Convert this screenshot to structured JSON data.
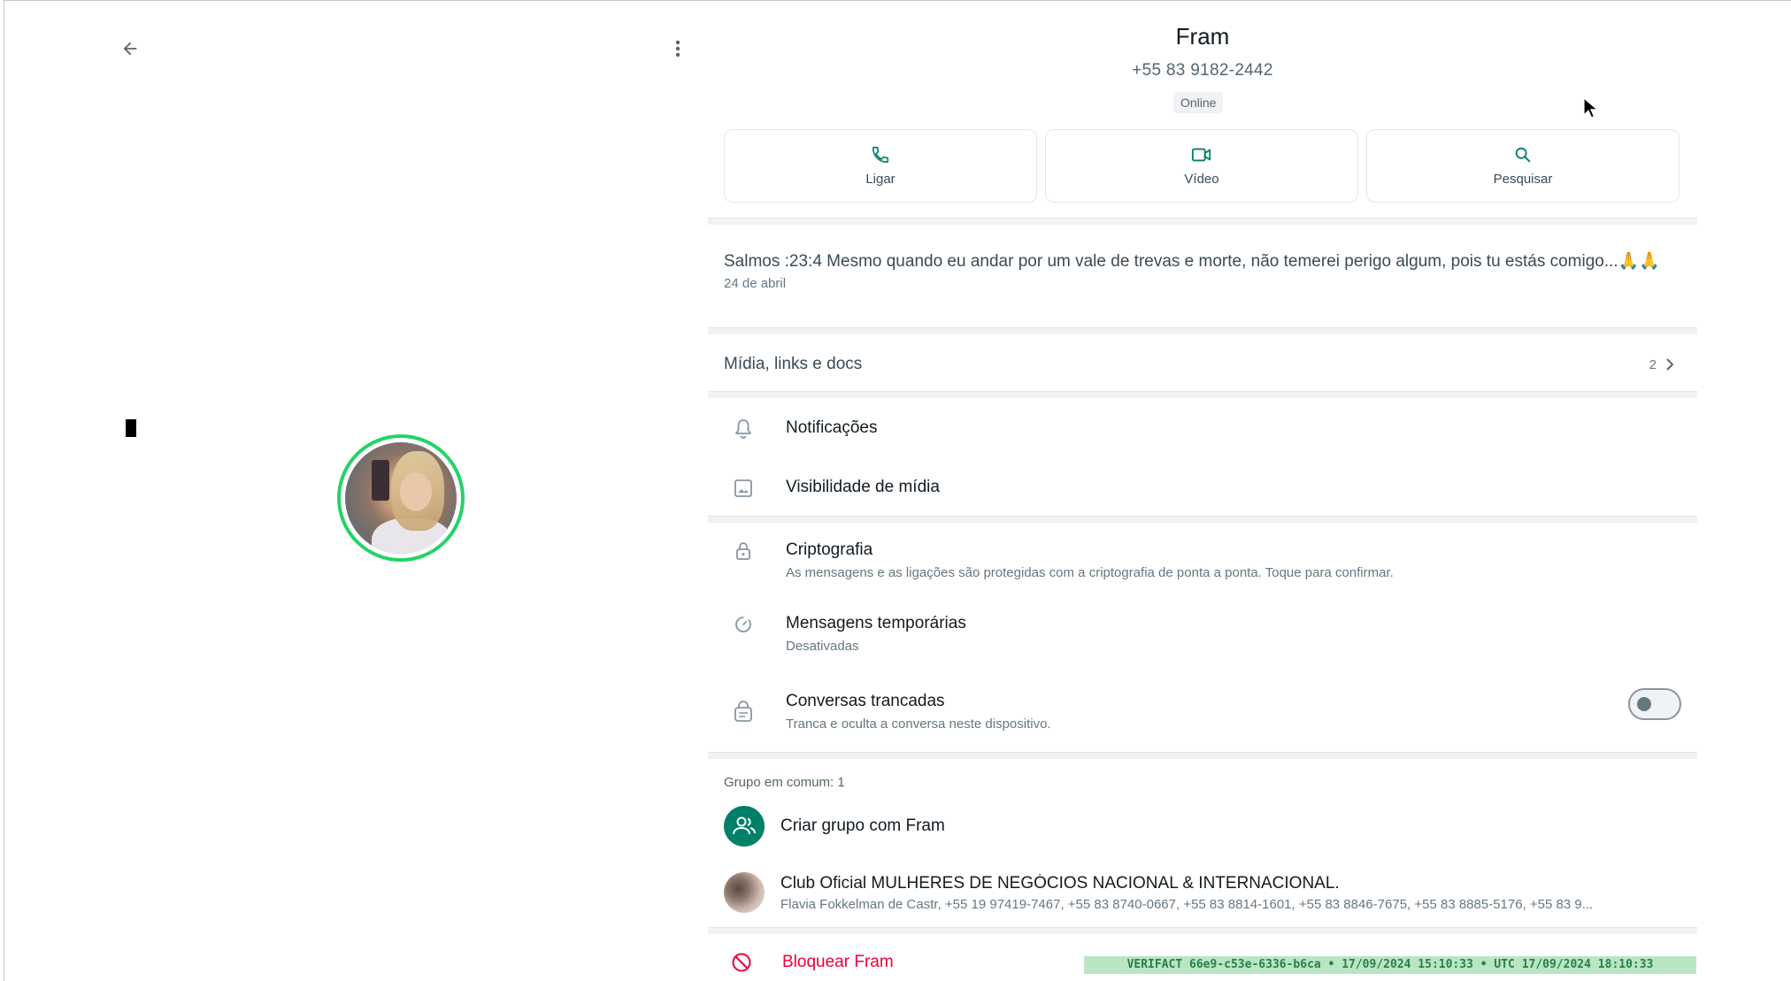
{
  "left_pane": {
    "back_icon": "arrow-left-icon",
    "menu_icon": "more-vertical-icon"
  },
  "contact": {
    "name": "Fram",
    "phone": "+55 83 9182-2442",
    "status": "Online"
  },
  "actions": [
    {
      "label": "Ligar",
      "icon": "phone-icon"
    },
    {
      "label": "Vídeo",
      "icon": "video-icon"
    },
    {
      "label": "Pesquisar",
      "icon": "search-icon"
    }
  ],
  "about": {
    "text": "Salmos :23:4 Mesmo quando eu andar por um vale de trevas e morte, não temerei perigo algum, pois tu estás comigo...🙏🙏",
    "date": "24 de abril"
  },
  "media": {
    "label": "Mídia, links e docs",
    "count": "2"
  },
  "settings": {
    "notifications": "Notificações",
    "media_visibility": "Visibilidade de mídia",
    "encryption_title": "Criptografia",
    "encryption_sub": "As mensagens e as ligações são protegidas com a criptografia de ponta a ponta. Toque para confirmar.",
    "temp_title": "Mensagens temporárias",
    "temp_sub": "Desativadas",
    "locked_title": "Conversas trancadas",
    "locked_sub": "Tranca e oculta a conversa neste dispositivo.",
    "locked_enabled": false
  },
  "groups": {
    "header": "Grupo em comum: 1",
    "create_label": "Criar grupo com Fram",
    "group_title": "Club Oficial MULHERES DE NEGÓCIOS NACIONAL & INTERNACIONAL.",
    "group_members": "Flavia Fokkelman de Castr, +55 19 97419-7467, +55 83 8740-0667, +55 83 8814-1601, +55 83 8846-7675, +55 83 8885-5176, +55 83 9..."
  },
  "block_label": "Bloquear Fram",
  "verifact": "VERIFACT 66e9-c53e-6336-b6ca • 17/09/2024 15:10:33 • UTC 17/09/2024 18:10:33",
  "colors": {
    "accent": "#008069",
    "danger": "#ea0038",
    "ring": "#25d366"
  }
}
